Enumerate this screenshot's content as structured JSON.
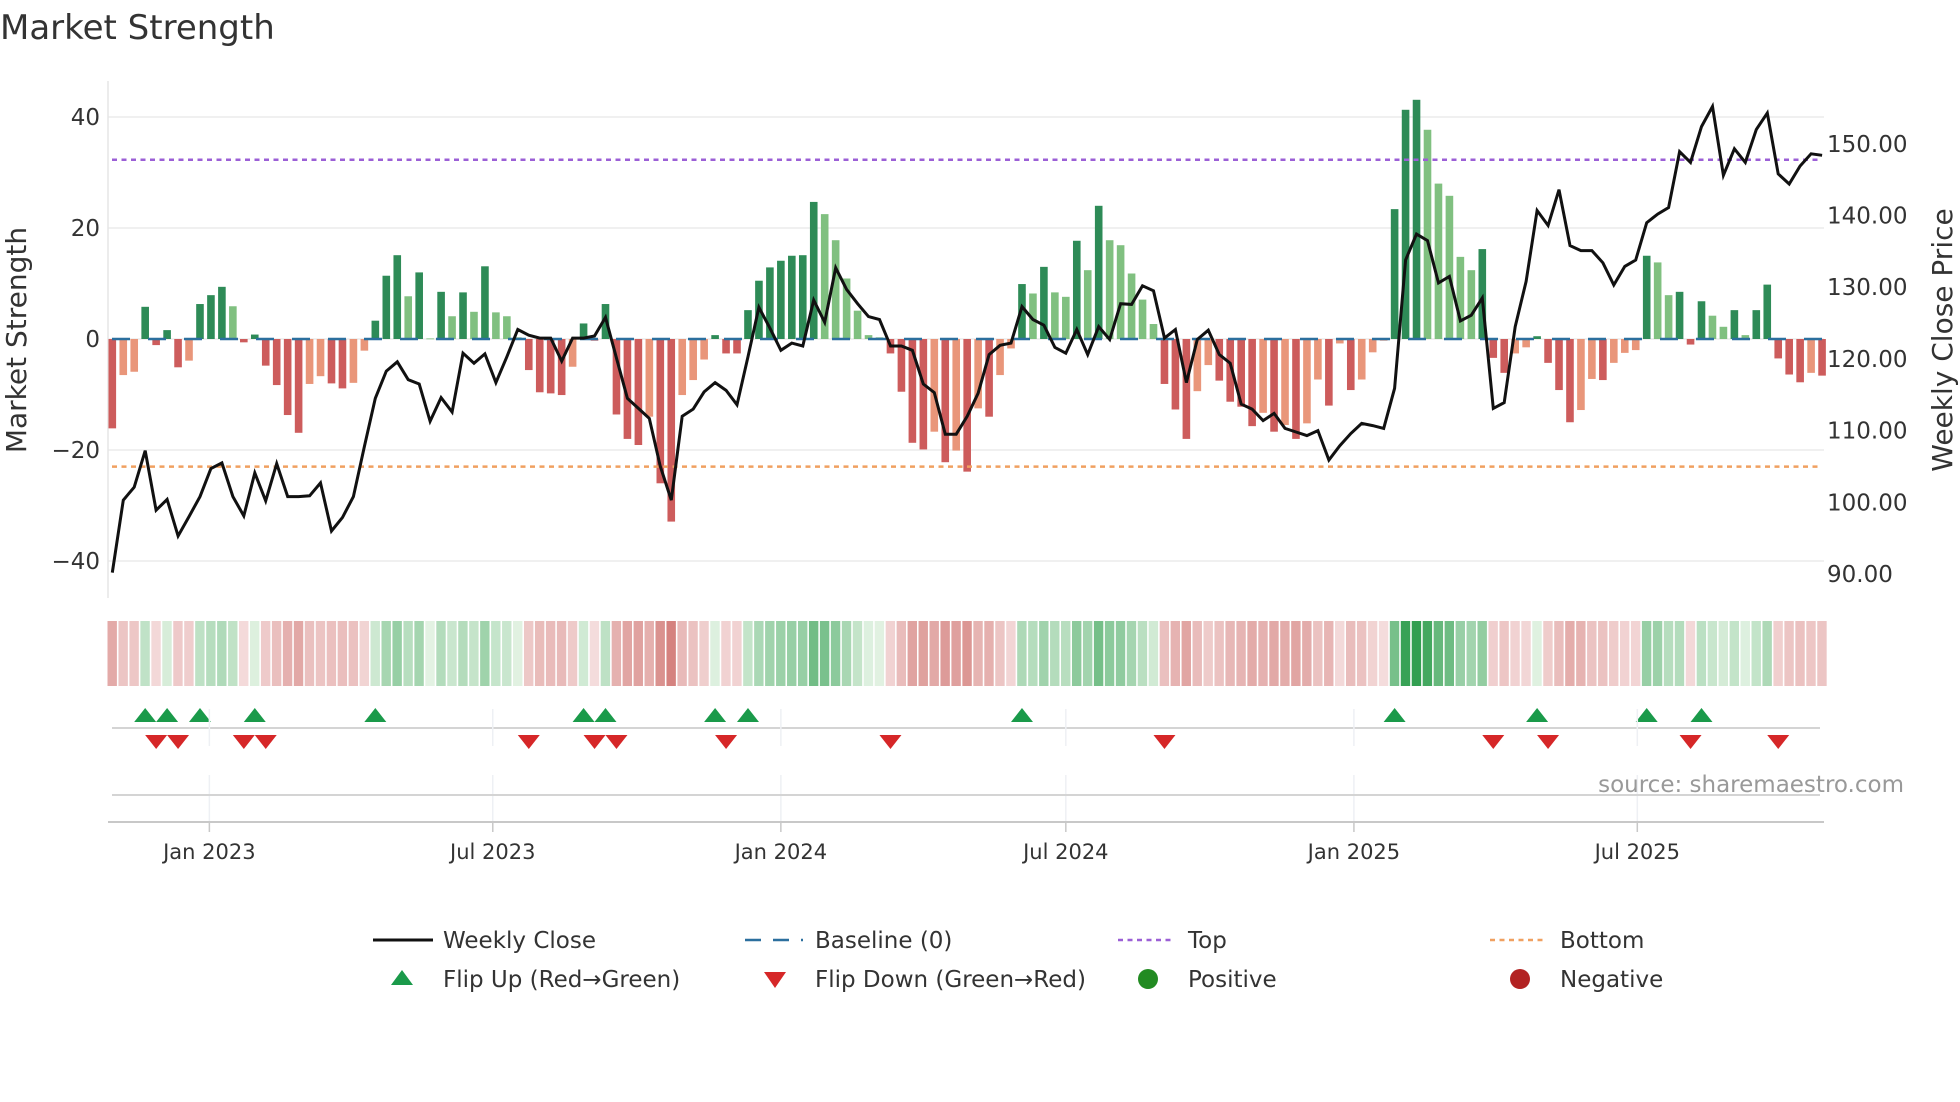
{
  "title": "Market Strength",
  "source": "source: sharemaestro.com",
  "colors": {
    "pos_strong": "#2e8b57",
    "pos_weak": "#80c080",
    "neg_strong": "#cd5c5c",
    "neg_weak": "#e9967a",
    "baseline": "#2b6f9e",
    "top": "#9b5fd6",
    "bottom": "#f0a060",
    "flip_up": "#1a9a4a",
    "flip_down": "#d62728",
    "positive": "#228b22",
    "negative": "#b22222",
    "line": "#111111"
  },
  "legend": [
    {
      "label": "Weekly Close",
      "icon": "solid-line"
    },
    {
      "label": "Baseline (0)",
      "icon": "dashed-line"
    },
    {
      "label": "Top",
      "icon": "dotted-line-purple"
    },
    {
      "label": "Bottom",
      "icon": "dotted-line-orange"
    },
    {
      "label": "Flip Up (Red→Green)",
      "icon": "triangle-up"
    },
    {
      "label": "Flip Down (Green→Red)",
      "icon": "triangle-down"
    },
    {
      "label": "Positive",
      "icon": "circle-green"
    },
    {
      "label": "Negative",
      "icon": "circle-red"
    }
  ],
  "chart_data": {
    "type": "bar",
    "title": "Market Strength",
    "ylabel": "Market Strength",
    "y2label": "Weekly Close Price",
    "xlabel": "",
    "interval": "weekly",
    "start_date": "2022-10-31",
    "ylim": [
      -46,
      47
    ],
    "y2lim": [
      87.9,
      165.5
    ],
    "yticks": [
      {
        "v": 40,
        "label": "40"
      },
      {
        "v": 20,
        "label": "20"
      },
      {
        "v": 0,
        "label": "0"
      },
      {
        "v": -20,
        "label": "−20"
      },
      {
        "v": -40,
        "label": "−40"
      }
    ],
    "y2ticks": [
      {
        "v": 150,
        "label": "150.00"
      },
      {
        "v": 140,
        "label": "140.00"
      },
      {
        "v": 130,
        "label": "130.00"
      },
      {
        "v": 120,
        "label": "120.00"
      },
      {
        "v": 110,
        "label": "110.00"
      },
      {
        "v": 100,
        "label": "100.00"
      },
      {
        "v": 90,
        "label": "90.00"
      }
    ],
    "xticks": [
      {
        "date": "2023-01-01",
        "label": "Jan 2023"
      },
      {
        "date": "2023-07-01",
        "label": "Jul 2023"
      },
      {
        "date": "2024-01-01",
        "label": "Jan 2024"
      },
      {
        "date": "2024-07-01",
        "label": "Jul 2024"
      },
      {
        "date": "2025-01-01",
        "label": "Jan 2025"
      },
      {
        "date": "2025-07-01",
        "label": "Jul 2025"
      }
    ],
    "top_level": 32.3,
    "bottom_level": -23.0,
    "baseline": 0,
    "strength": [
      -16.1,
      -6.5,
      -5.9,
      5.8,
      -1.1,
      1.6,
      -5.1,
      -3.9,
      6.3,
      7.9,
      9.4,
      5.9,
      -0.6,
      0.8,
      -4.8,
      -8.3,
      -13.7,
      -16.9,
      -8.1,
      -6.7,
      -8.0,
      -8.9,
      -7.9,
      -2.1,
      3.3,
      11.4,
      15.1,
      7.7,
      12.0,
      0.1,
      8.5,
      4.1,
      8.4,
      4.9,
      13.1,
      4.8,
      4.1,
      0.3,
      -5.6,
      -9.6,
      -9.8,
      -10.1,
      -5.0,
      2.8,
      -0.3,
      6.3,
      -13.6,
      -18.0,
      -19.1,
      -14.0,
      -26.0,
      -32.9,
      -10.1,
      -7.4,
      -3.7,
      0.7,
      -2.6,
      -2.6,
      5.2,
      10.5,
      12.9,
      14.1,
      15.0,
      15.1,
      24.7,
      22.5,
      17.8,
      10.9,
      5.1,
      0.7,
      0.3,
      -2.6,
      -9.5,
      -18.7,
      -19.9,
      -16.7,
      -22.2,
      -20.1,
      -23.9,
      -12.5,
      -14.0,
      -6.5,
      -1.7,
      9.9,
      8.2,
      13.0,
      8.4,
      7.6,
      17.7,
      12.4,
      24.0,
      17.8,
      16.9,
      11.8,
      7.1,
      2.7,
      -8.1,
      -12.7,
      -18.0,
      -9.4,
      -4.7,
      -7.5,
      -11.3,
      -12.2,
      -15.7,
      -13.3,
      -16.7,
      -15.5,
      -18.0,
      -15.2,
      -7.3,
      -12.0,
      -0.8,
      -9.2,
      -7.3,
      -2.4,
      -0.3,
      23.4,
      41.3,
      43.1,
      37.7,
      28.0,
      25.8,
      14.8,
      12.4,
      16.2,
      -3.4,
      -6.1,
      -2.6,
      -1.5,
      0.5,
      -4.3,
      -9.2,
      -15.0,
      -12.8,
      -7.2,
      -7.4,
      -4.3,
      -2.5,
      -2.0,
      15.0,
      13.8,
      7.9,
      8.5,
      -1.0,
      6.8,
      4.2,
      2.2,
      5.2,
      0.7,
      5.2,
      9.8,
      -3.5,
      -6.4,
      -7.8,
      -6.1,
      -6.6
    ],
    "weekly_close": [
      90.2,
      100.3,
      102.1,
      107.2,
      98.9,
      100.4,
      95.3,
      98.0,
      100.8,
      104.7,
      105.5,
      100.8,
      98.1,
      104.1,
      100.2,
      105.4,
      100.8,
      100.8,
      100.9,
      102.7,
      96.0,
      97.9,
      100.8,
      107.8,
      114.5,
      118.3,
      119.6,
      117.1,
      116.5,
      111.3,
      114.6,
      112.6,
      120.8,
      119.4,
      120.7,
      116.7,
      120.3,
      124.1,
      123.3,
      122.9,
      122.9,
      119.7,
      122.9,
      122.9,
      123.2,
      125.8,
      120.1,
      114.5,
      113.1,
      111.7,
      105.0,
      100.3,
      112.0,
      113.0,
      115.4,
      116.7,
      115.6,
      113.6,
      120.3,
      127.2,
      124.3,
      121.2,
      122.2,
      121.8,
      128.2,
      125.1,
      132.7,
      129.7,
      127.7,
      125.9,
      125.5,
      121.8,
      121.8,
      121.2,
      116.5,
      115.3,
      109.5,
      109.5,
      112.0,
      115.2,
      120.6,
      121.9,
      122.2,
      127.3,
      125.5,
      124.7,
      121.6,
      120.8,
      124.1,
      120.6,
      124.5,
      122.7,
      127.7,
      127.6,
      130.2,
      129.5,
      122.9,
      124.1,
      116.7,
      122.7,
      124.0,
      120.6,
      119.4,
      113.7,
      113.0,
      111.4,
      112.4,
      110.3,
      109.8,
      109.3,
      110.0,
      105.9,
      107.9,
      109.6,
      111.0,
      110.7,
      110.3,
      115.9,
      133.8,
      137.4,
      136.5,
      130.6,
      131.5,
      125.3,
      126.1,
      128.5,
      113.1,
      113.9,
      124.5,
      130.8,
      140.7,
      138.6,
      143.6,
      135.8,
      135.1,
      135.1,
      133.4,
      130.3,
      132.9,
      133.8,
      139.0,
      140.2,
      141.1,
      148.9,
      147.4,
      152.4,
      155.2,
      145.6,
      149.3,
      147.4,
      152.0,
      154.3,
      145.8,
      144.4,
      146.9,
      148.6,
      148.4
    ]
  }
}
